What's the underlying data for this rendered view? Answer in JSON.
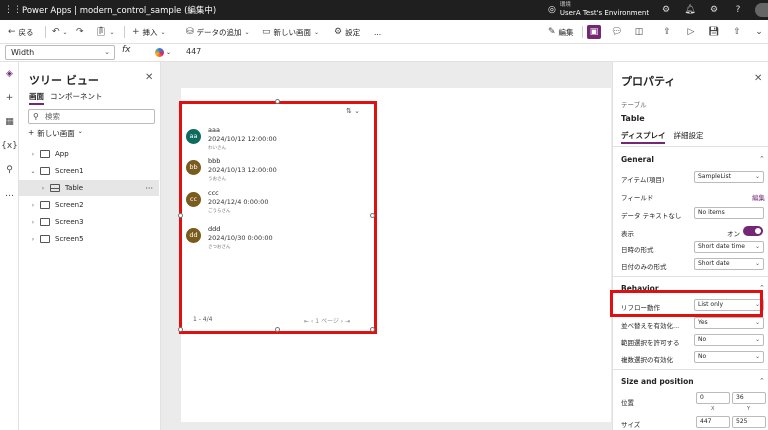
{
  "titlebar": {
    "app_title": "Power Apps | modern_control_sample (編集中)",
    "env_label": "環境",
    "env_name": "UserA Test's Environment"
  },
  "toolbar": {
    "back": "戻る",
    "insert": "挿入",
    "add_data": "データの追加",
    "new_screen": "新しい画面",
    "settings": "設定",
    "more": "...",
    "edit": "編集"
  },
  "formula": {
    "property": "Width",
    "fx": "fx",
    "value": "447"
  },
  "tree": {
    "title": "ツリー ビュー",
    "tab_screens": "画面",
    "tab_components": "コンポーネント",
    "search_placeholder": "検索",
    "new_screen": "新しい画面",
    "nodes": [
      {
        "label": "App"
      },
      {
        "label": "Screen1"
      },
      {
        "label": "Table"
      },
      {
        "label": "Screen2"
      },
      {
        "label": "Screen3"
      },
      {
        "label": "Screen5"
      }
    ]
  },
  "table": {
    "rows": [
      {
        "initials": "aa",
        "name": "aaa",
        "date": "2024/10/12 12:00:00",
        "sub": "わいさん",
        "color": "#0f6b5e"
      },
      {
        "initials": "bb",
        "name": "bbb",
        "date": "2024/10/13 12:00:00",
        "sub": "うおさん",
        "color": "#7a5a1d"
      },
      {
        "initials": "cc",
        "name": "ccc",
        "date": "2024/12/4 0:00:00",
        "sub": "ごうらさん",
        "color": "#7a5a1d"
      },
      {
        "initials": "dd",
        "name": "ddd",
        "date": "2024/10/30 0:00:00",
        "sub": "さつおさん",
        "color": "#7a5a1d"
      }
    ],
    "pagination": "1 - 4/4",
    "page_label": "1 ページ"
  },
  "props": {
    "title": "プロパティ",
    "control_type": "テーブル",
    "control_name": "Table",
    "tab_display": "ディスプレイ",
    "tab_advanced": "詳細設定",
    "general": "General",
    "items_label": "アイテム(項目)",
    "items_value": "SampleList",
    "fields_label": "フィールド",
    "fields_link": "編集",
    "nodata_label": "データ テキストなし",
    "nodata_value": "No items",
    "visible_label": "表示",
    "visible_value": "オン",
    "datetime_label": "日時の形式",
    "datetime_value": "Short date time",
    "dateonly_label": "日付のみの形式",
    "dateonly_value": "Short date",
    "behavior": "Behavior",
    "reflow_label": "リフロー動作",
    "reflow_value": "List only",
    "sort_label": "並べ替えを有効化...",
    "sort_value": "Yes",
    "range_label": "範囲選択を許可する",
    "range_value": "No",
    "multi_label": "複数選択の有効化",
    "multi_value": "No",
    "size_position": "Size and position",
    "position_label": "位置",
    "pos_x": "0",
    "pos_y": "36",
    "x_label": "X",
    "y_label": "Y",
    "size_label": "サイズ",
    "size_w": "447",
    "size_h": "525"
  }
}
